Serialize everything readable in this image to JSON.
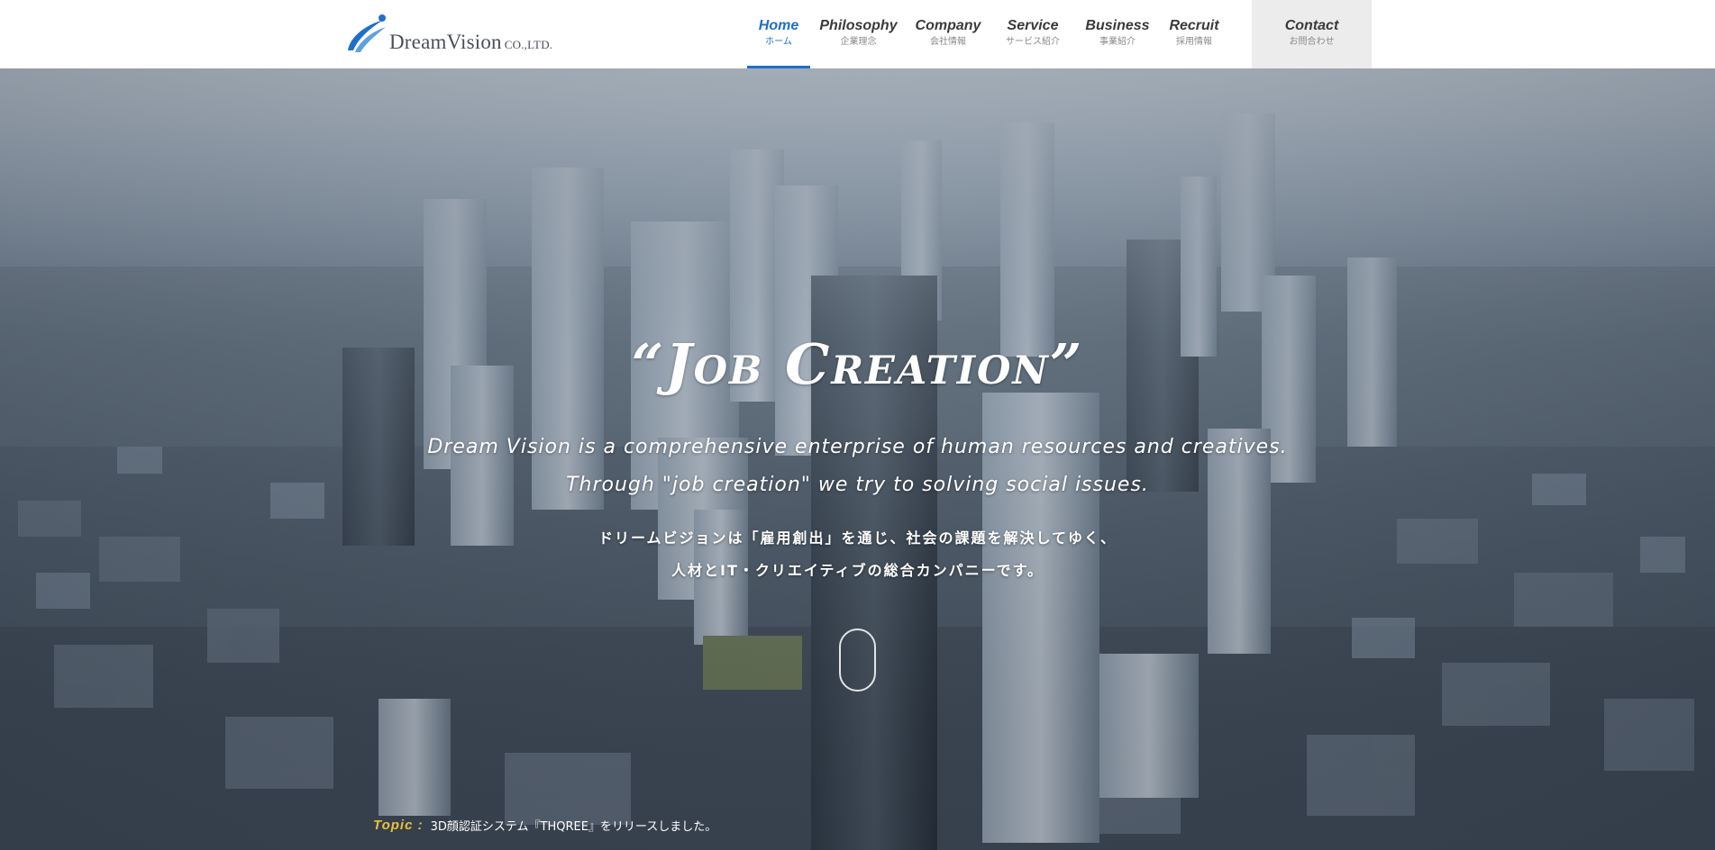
{
  "brand": {
    "name": "DreamVision",
    "suffix": "CO.,LTD.",
    "logo_icon": "swoosh-logo-icon",
    "color": "#1f6fc8"
  },
  "nav": {
    "items": [
      {
        "en": "Home",
        "jp": "ホーム",
        "active": true
      },
      {
        "en": "Philosophy",
        "jp": "企業理念",
        "active": false
      },
      {
        "en": "Company",
        "jp": "会社情報",
        "active": false
      },
      {
        "en": "Service",
        "jp": "サービス紹介",
        "active": false
      },
      {
        "en": "Business",
        "jp": "事業紹介",
        "active": false
      },
      {
        "en": "Recruit",
        "jp": "採用情報",
        "active": false
      }
    ],
    "contact": {
      "en": "Contact",
      "jp": "お問合わせ"
    },
    "active_color": "#1f6fc8"
  },
  "hero": {
    "tagline": "“Job Creation”",
    "description_en": [
      "Dream Vision is a comprehensive enterprise of human resources and creatives.",
      "Through \"job creation\" we try to solving social issues."
    ],
    "description_jp": [
      "ドリームビジョンは「雇用創出」を通じ、社会の課題を解決してゆく、",
      "人材とIT・クリエイティブの総合カンパニーです。"
    ],
    "scroll_icon": "mouse-scroll-icon"
  },
  "topic": {
    "label": "Topic :",
    "text": "3D顔認証システム『THQREE』をリリースしました。",
    "label_color": "#e8c23a"
  }
}
